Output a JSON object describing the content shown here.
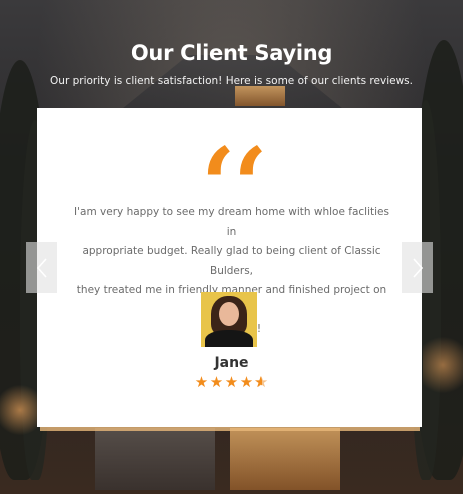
{
  "section": {
    "title": "Our Client Saying",
    "subtitle": "Our priority is client satisfaction! Here is some of our clients reviews."
  },
  "testimonial": {
    "quote_icon": "quote-icon",
    "review_lines": [
      "I'am very happy to see my dream home with whloe faclities in",
      "appropriate budget. Really glad to being client of Classic Bulders,",
      "they treated me in friendly manner and finished project on time.",
      "Thank you!"
    ],
    "client_name": "Jane",
    "rating": 4.5,
    "rating_max": 5,
    "accent_color": "#f28c1c"
  },
  "carousel": {
    "prev_icon": "chevron-left-icon",
    "next_icon": "chevron-right-icon"
  }
}
